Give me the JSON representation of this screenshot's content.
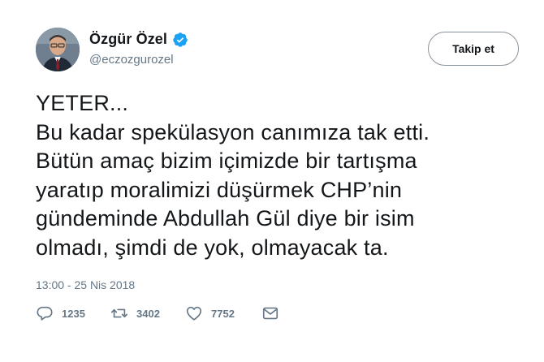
{
  "author": {
    "display_name": "Özgür Özel",
    "handle": "@eczozgurozel",
    "verified": true,
    "verified_color": "#1da1f2",
    "avatar_icon": "profile-photo"
  },
  "follow_button": {
    "label": "Takip et"
  },
  "tweet": {
    "lines": [
      "YETER...",
      "Bu kadar spekülasyon canımıza tak etti.",
      "Bütün amaç bizim içimizde bir tartışma",
      "yaratıp moralimizi düşürmek CHP’nin",
      "gündeminde Abdullah Gül diye bir isim",
      "olmadı, şimdi de yok, olmayacak ta."
    ],
    "timestamp": "13:00 - 25 Nis 2018"
  },
  "actions": {
    "reply": {
      "icon": "reply-icon",
      "count": "1235"
    },
    "retweet": {
      "icon": "retweet-icon",
      "count": "3402"
    },
    "like": {
      "icon": "heart-icon",
      "count": "7752"
    },
    "message": {
      "icon": "envelope-icon"
    }
  },
  "colors": {
    "text": "#14171a",
    "secondary": "#657786",
    "background": "#ffffff"
  }
}
